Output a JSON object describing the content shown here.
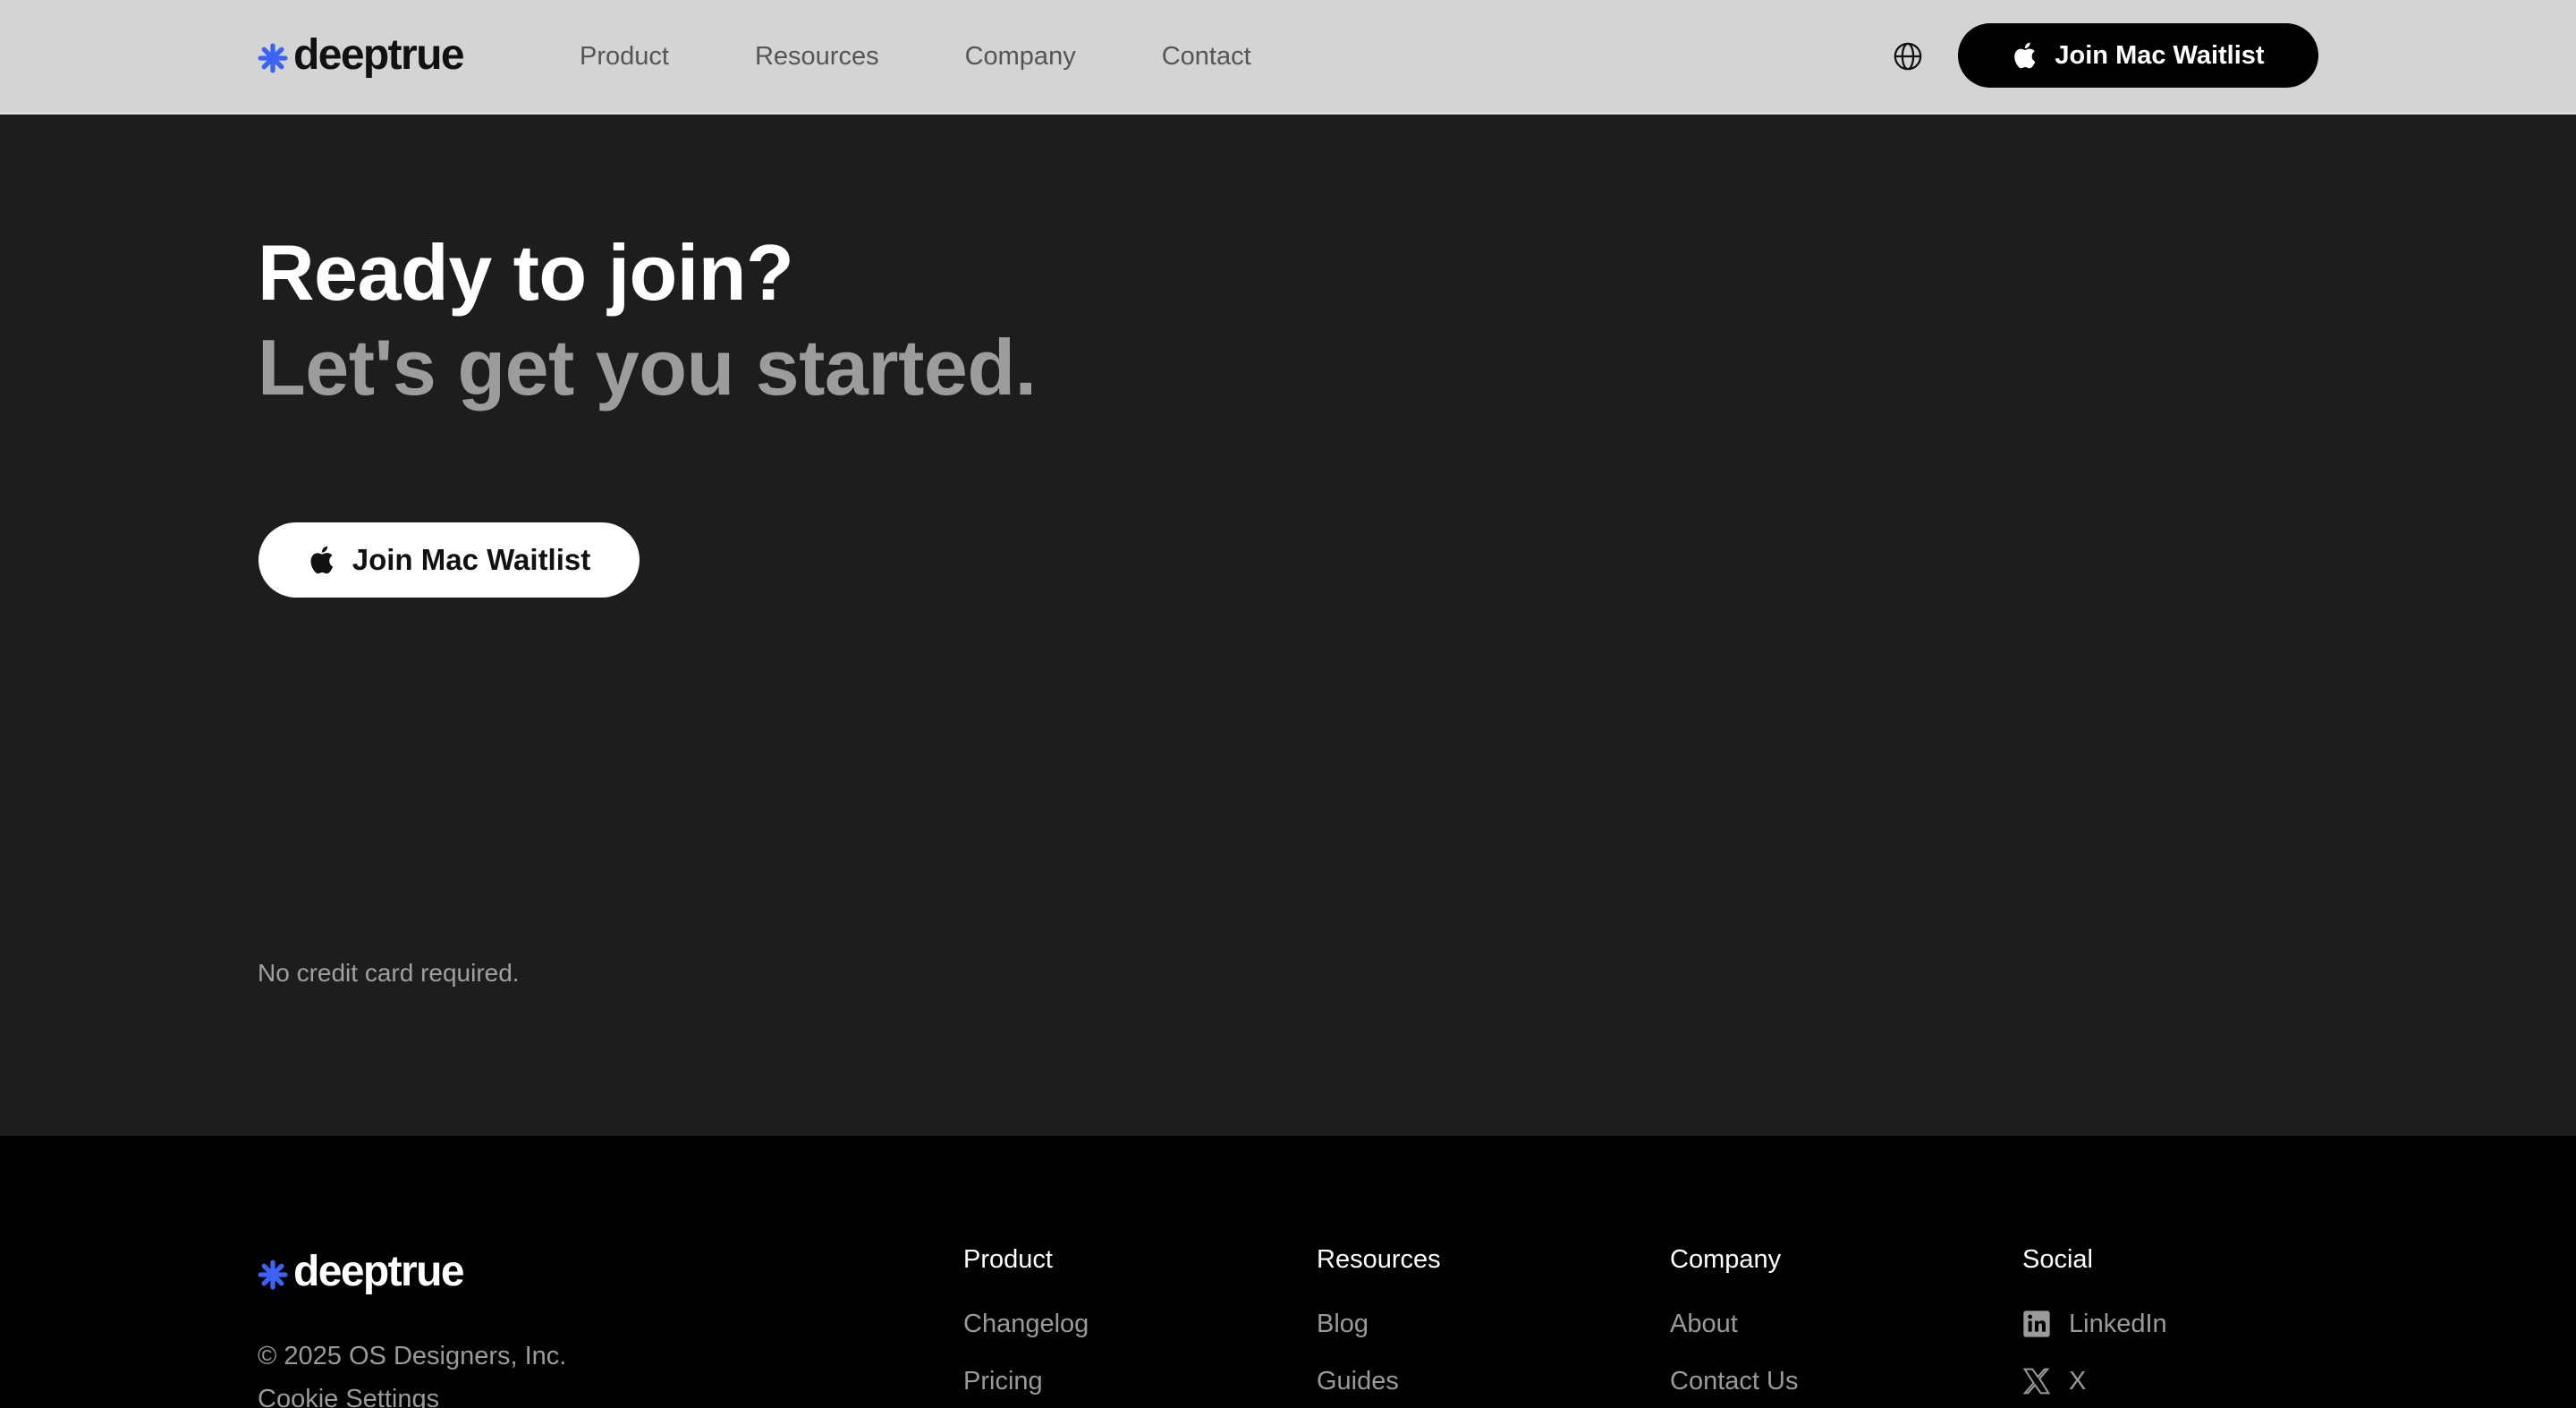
{
  "brand": {
    "name": "deeptrue",
    "accent": "#3b63f5"
  },
  "nav": {
    "links": [
      "Product",
      "Resources",
      "Company",
      "Contact"
    ],
    "language_icon": "globe-icon",
    "cta_label": "Join Mac Waitlist",
    "cta_icon": "apple-icon"
  },
  "hero": {
    "headline": "Ready to join?",
    "subheadline": "Let's get you started.",
    "cta_label": "Join Mac Waitlist",
    "note": "No credit card required."
  },
  "footer": {
    "copyright": "© 2025 OS Designers, Inc.",
    "cookie_settings": "Cookie Settings",
    "columns": [
      {
        "title": "Product",
        "links": [
          "Changelog",
          "Pricing"
        ]
      },
      {
        "title": "Resources",
        "links": [
          "Blog",
          "Guides"
        ]
      },
      {
        "title": "Company",
        "links": [
          "About",
          "Contact Us"
        ]
      },
      {
        "title": "Social",
        "links": [
          "LinkedIn",
          "X"
        ],
        "icons": [
          "linkedin-icon",
          "x-icon"
        ]
      }
    ]
  }
}
